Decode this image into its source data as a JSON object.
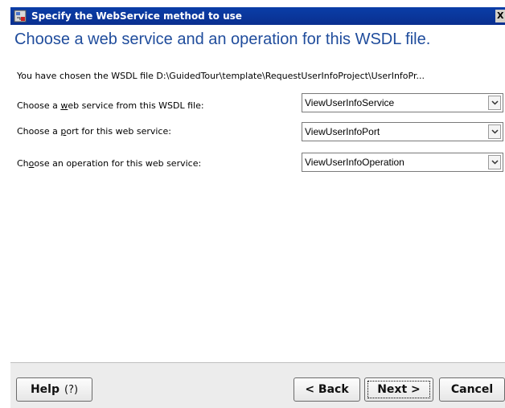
{
  "window": {
    "title": "Specify the WebService method to use",
    "close_glyph": "X"
  },
  "header": {
    "title": "Choose a web service and an operation for this WSDL file."
  },
  "intro": {
    "text": "You have chosen the WSDL file D:\\GuidedTour\\template\\RequestUserInfoProject\\UserInfoPr..."
  },
  "rows": [
    {
      "label_pre": "Choose a ",
      "label_u": "w",
      "label_post": "eb service from this WSDL file:",
      "value": "ViewUserInfoService"
    },
    {
      "label_pre": "Choose a ",
      "label_u": "p",
      "label_post": "ort for this web service:",
      "value": "ViewUserInfoPort"
    },
    {
      "label_pre": "Ch",
      "label_u": "o",
      "label_post": "ose an operation for this web service:",
      "value": "ViewUserInfoOperation"
    }
  ],
  "buttons": {
    "help": "Help",
    "help_icon": "?",
    "back": "< Back",
    "next": "Next >",
    "cancel": "Cancel"
  },
  "colors": {
    "title_bar": "#0a3ea8",
    "header_text": "#1f4c9c",
    "footer_bg": "#ececec"
  }
}
